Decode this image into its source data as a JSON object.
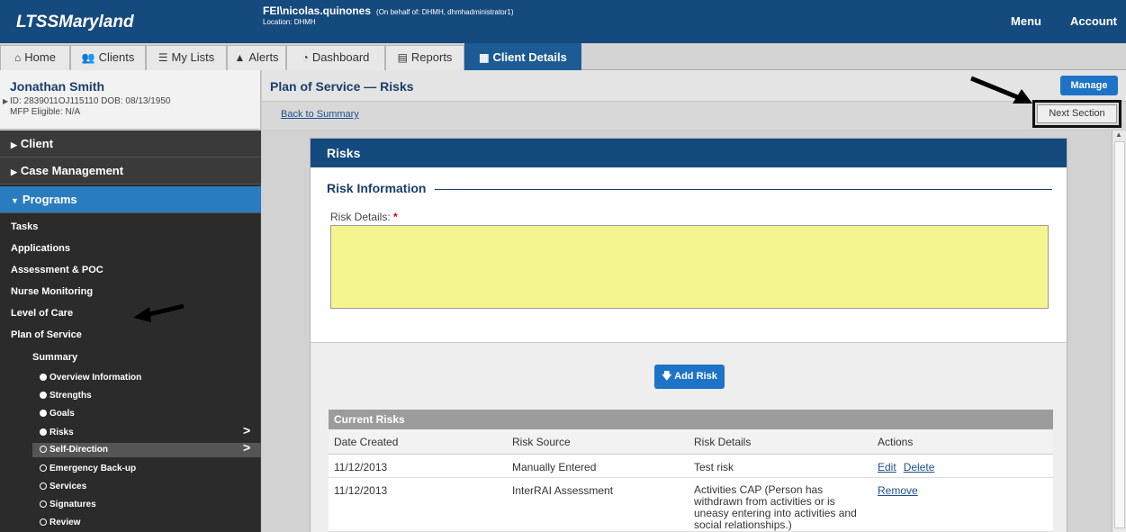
{
  "topbar": {
    "brand": "LTSSMaryland",
    "user": "FEI\\nicolas.quinones",
    "behalf": "(On behalf of: DHMH, dhmhadministrator1)",
    "location": "Location: DHMH",
    "menu": "Menu",
    "account": "Account"
  },
  "tabs": [
    {
      "label": "Home",
      "icon": "home-icon"
    },
    {
      "label": "Clients",
      "icon": "clients-icon"
    },
    {
      "label": "My Lists",
      "icon": "list-icon"
    },
    {
      "label": "Alerts",
      "icon": "alert-icon"
    },
    {
      "label": "Dashboard",
      "icon": "dashboard-icon"
    },
    {
      "label": "Reports",
      "icon": "reports-icon"
    },
    {
      "label": "Client Details",
      "icon": "client-details-icon"
    }
  ],
  "client": {
    "name": "Jonathan Smith",
    "ids": "ID: 2839011OJ115110 DOB: 08/13/1950",
    "mfp": "MFP Eligible: N/A"
  },
  "page": {
    "title": "Plan of Service — Risks",
    "back": "Back to Summary",
    "manage": "Manage",
    "next_section": "Next Section"
  },
  "sidebar": {
    "sections": [
      "Client",
      "Case Management",
      "Programs"
    ],
    "programs": [
      "Tasks",
      "Applications",
      "Assessment & POC",
      "Nurse Monitoring",
      "Level of Care",
      "Plan of Service"
    ],
    "summary": "Summary",
    "items": [
      {
        "label": "Overview Information",
        "done": true
      },
      {
        "label": "Strengths",
        "done": true
      },
      {
        "label": "Goals",
        "done": true
      },
      {
        "label": "Risks",
        "done": true
      },
      {
        "label": "Self-Direction",
        "done": false
      },
      {
        "label": "Emergency Back-up",
        "done": false
      },
      {
        "label": "Services",
        "done": false
      },
      {
        "label": "Signatures",
        "done": false
      },
      {
        "label": "Review",
        "done": false
      }
    ]
  },
  "card": {
    "title": "Risks",
    "legend": "Risk Information",
    "risk_details_label": "Risk Details:",
    "required_mark": "*",
    "add_risk": "Add Risk"
  },
  "table": {
    "title": "Current Risks",
    "columns": [
      "Date Created",
      "Risk Source",
      "Risk Details",
      "Actions"
    ],
    "rows": [
      {
        "date": "11/12/2013",
        "source": "Manually Entered",
        "details": "Test risk",
        "actions": [
          "Edit",
          "Delete"
        ]
      },
      {
        "date": "11/12/2013",
        "source": "InterRAI Assessment",
        "details": "Activities CAP (Person has withdrawn from activities or is uneasy entering into activities and social relationships.)",
        "actions": [
          "Remove"
        ]
      }
    ]
  },
  "colors": {
    "brand": "#154a7e",
    "active_nav": "#2a7cc0",
    "button": "#1d73c6",
    "textarea": "#f5f58f"
  }
}
